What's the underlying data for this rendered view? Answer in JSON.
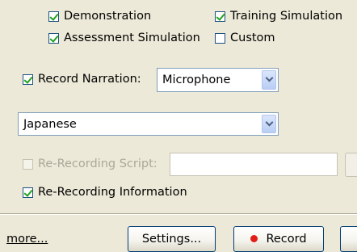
{
  "options": {
    "demonstration": {
      "label": "Demonstration",
      "checked": true
    },
    "training_simulation": {
      "label": "Training Simulation",
      "checked": true
    },
    "assessment_simulation": {
      "label": "Assessment Simulation",
      "checked": true
    },
    "custom": {
      "label": "Custom",
      "checked": false
    }
  },
  "narration": {
    "checkbox_label": "Record Narration:",
    "checked": true,
    "source_value": "Microphone"
  },
  "language": {
    "value": "Japanese"
  },
  "rerecording_script": {
    "label": "Re-Recording Script:",
    "checked": false,
    "enabled": false,
    "value": ""
  },
  "rerecording_information": {
    "label": "Re-Recording Information",
    "checked": true
  },
  "footer": {
    "more_link": "more...",
    "settings_button": "Settings...",
    "record_button": "Record"
  }
}
